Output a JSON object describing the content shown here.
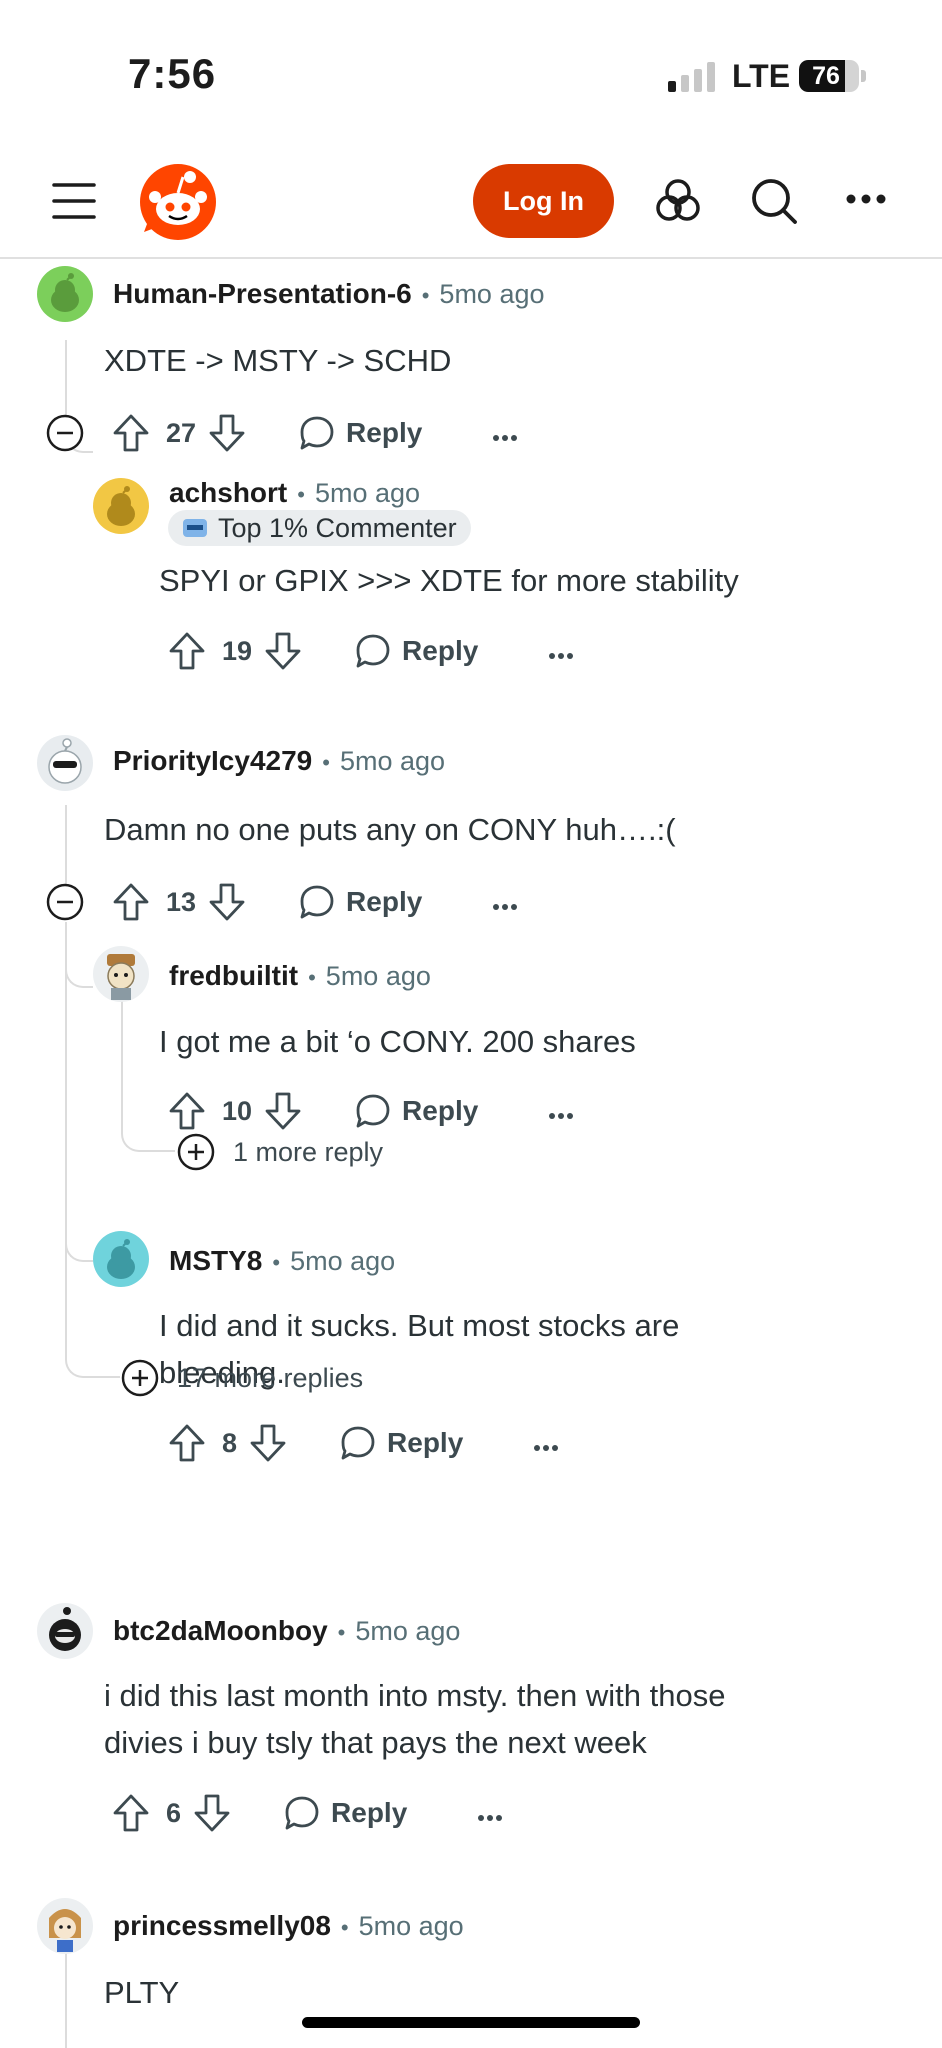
{
  "status_bar": {
    "time": "7:56",
    "network": "LTE",
    "battery": "76",
    "battery_level": 0.76
  },
  "header": {
    "login_label": "Log In"
  },
  "comments": [
    {
      "username": "Human-Presentation-6",
      "age": "5mo ago",
      "body": "XDTE -> MSTY -> SCHD",
      "votes": "27",
      "reply_label": "Reply",
      "avatar": "green-snoo"
    },
    {
      "username": "achshort",
      "age": "5mo ago",
      "flair": "Top 1% Commenter",
      "body": "SPYI or GPIX >>> XDTE for more stability",
      "votes": "19",
      "reply_label": "Reply",
      "avatar": "yellow-snoo"
    },
    {
      "username": "PriorityIcy4279",
      "age": "5mo ago",
      "body": "Damn no one puts any on CONY huh….:(",
      "votes": "13",
      "reply_label": "Reply",
      "avatar": "sunglasses-snoo"
    },
    {
      "username": "fredbuiltit",
      "age": "5mo ago",
      "body": "I got me a bit ‘o CONY. 200 shares",
      "votes": "10",
      "reply_label": "Reply",
      "avatar": "hat-snoo"
    },
    {
      "username": "MSTY8",
      "age": "5mo ago",
      "body_line1": "I did and it sucks. But most stocks are",
      "body_line2": "bleeding.",
      "votes": "8",
      "reply_label": "Reply",
      "avatar": "teal-snoo"
    },
    {
      "username": "btc2daMoonboy",
      "age": "5mo ago",
      "body_line1": "i did this last month into msty. then with those",
      "body_line2": "divies i buy tsly that pays the next week",
      "votes": "6",
      "reply_label": "Reply",
      "avatar": "black-hood-snoo"
    },
    {
      "username": "princessmelly08",
      "age": "5mo ago",
      "body": "PLTY",
      "avatar": "princess-snoo"
    }
  ],
  "more_replies": [
    {
      "label": "1 more reply"
    },
    {
      "label": "17 more replies"
    }
  ],
  "colors": {
    "brand": "#d93a00",
    "meta": "#576f76",
    "thread": "#dcdcdc"
  }
}
